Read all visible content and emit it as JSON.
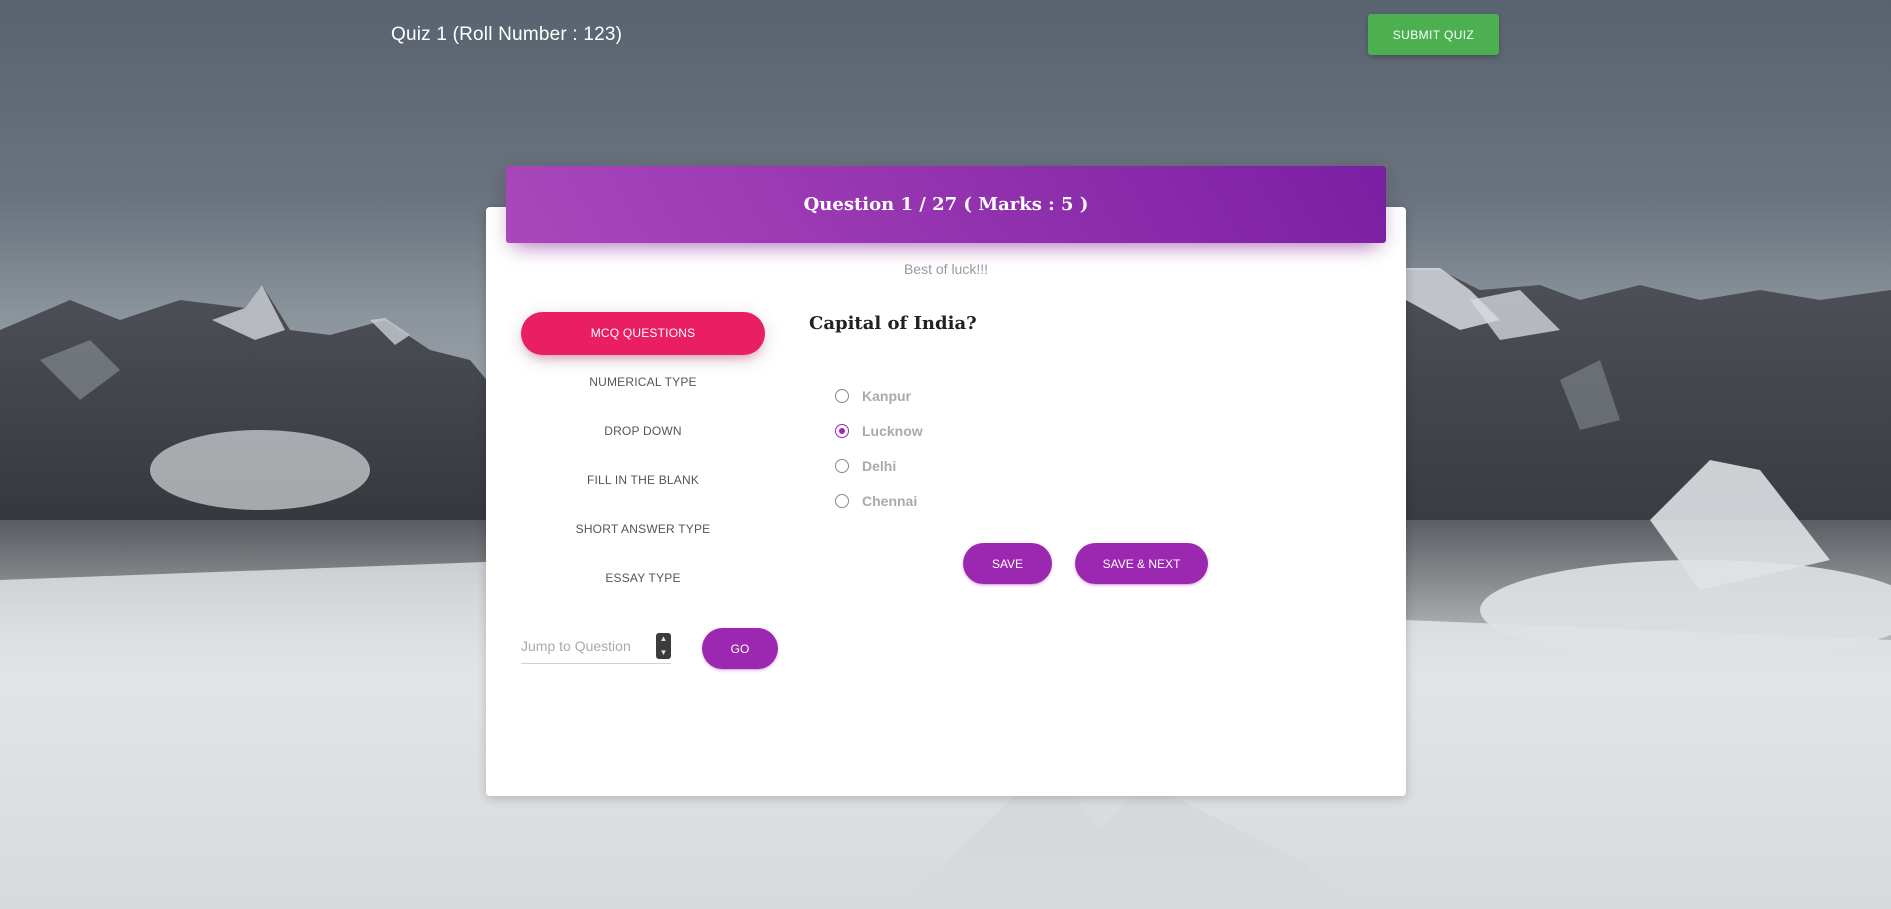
{
  "header": {
    "quiz_title": "Quiz 1 (Roll Number : 123)",
    "submit_label": "SUBMIT QUIZ"
  },
  "card": {
    "title": "Question 1 / 27 ( Marks : 5 )",
    "subtitle": "Best of luck!!!"
  },
  "nav": {
    "items": [
      {
        "label": "MCQ QUESTIONS",
        "active": true
      },
      {
        "label": "NUMERICAL TYPE",
        "active": false
      },
      {
        "label": "DROP DOWN",
        "active": false
      },
      {
        "label": "FILL IN THE BLANK",
        "active": false
      },
      {
        "label": "SHORT ANSWER TYPE",
        "active": false
      },
      {
        "label": "ESSAY TYPE",
        "active": false
      }
    ]
  },
  "jump": {
    "placeholder": "Jump to Question",
    "value": "",
    "go_label": "GO"
  },
  "question": {
    "text": "Capital of India?",
    "options": [
      {
        "label": "Kanpur",
        "selected": false
      },
      {
        "label": "Lucknow",
        "selected": true
      },
      {
        "label": "Delhi",
        "selected": false
      },
      {
        "label": "Chennai",
        "selected": false
      }
    ],
    "save_label": "SAVE",
    "save_next_label": "SAVE & NEXT"
  },
  "colors": {
    "accent": "#9c27b0",
    "active_tab": "#e91e63",
    "submit": "#4caf50"
  }
}
